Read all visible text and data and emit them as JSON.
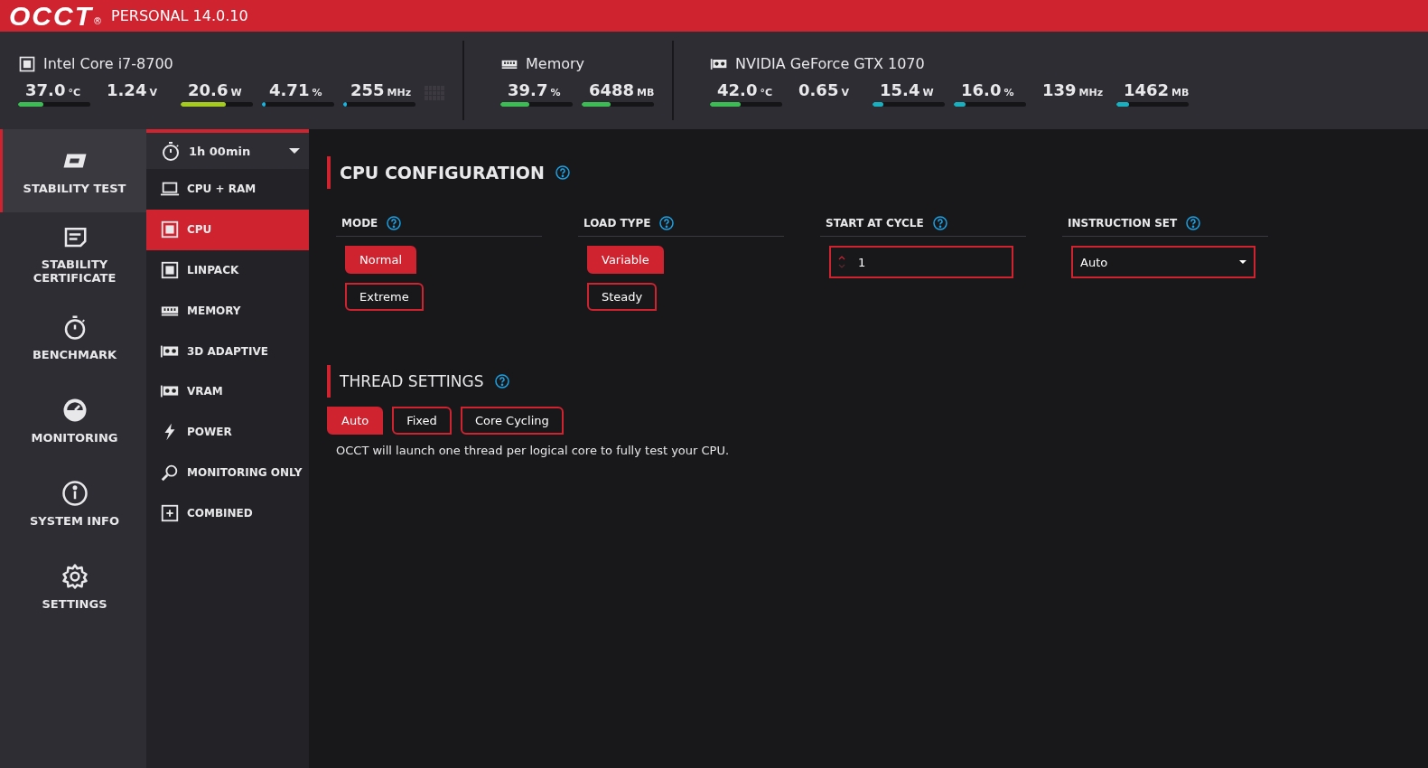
{
  "header": {
    "logo": "OCCT",
    "registered": "®",
    "edition": "PERSONAL 14.0.10"
  },
  "monitors": [
    {
      "kind": "cpu",
      "name": "Intel Core i7-8700",
      "metrics": [
        {
          "value": "37.0",
          "unit": "°C",
          "level": 0.35,
          "color": "#3dbb55"
        },
        {
          "value": "1.24",
          "unit": "V"
        },
        {
          "value": "20.6",
          "unit": "W",
          "level": 0.63,
          "color": "#a5cc1f"
        },
        {
          "value": "4.71",
          "unit": "%",
          "level": 0.05,
          "color": "#1cb5e0"
        },
        {
          "value": "255",
          "unit": "MHz",
          "level": 0.05,
          "color": "#1cb5e0"
        }
      ]
    },
    {
      "kind": "memory",
      "name": "Memory",
      "metrics": [
        {
          "value": "39.7",
          "unit": "%",
          "level": 0.4,
          "color": "#3dbb55"
        },
        {
          "value": "6488",
          "unit": "MB",
          "level": 0.4,
          "color": "#3dbb55"
        }
      ]
    },
    {
      "kind": "gpu",
      "name": "NVIDIA GeForce GTX 1070",
      "metrics": [
        {
          "value": "42.0",
          "unit": "°C",
          "level": 0.42,
          "color": "#3dbb55"
        },
        {
          "value": "0.65",
          "unit": "V"
        },
        {
          "value": "15.4",
          "unit": "W",
          "level": 0.15,
          "color": "#1ab0c0"
        },
        {
          "value": "16.0",
          "unit": "%",
          "level": 0.16,
          "color": "#1ab0c0"
        },
        {
          "value": "139",
          "unit": "MHz"
        },
        {
          "value": "1462",
          "unit": "MB",
          "level": 0.18,
          "color": "#1ab0c0"
        }
      ]
    }
  ],
  "nav": [
    {
      "kind": "stability",
      "label": "STABILITY TEST",
      "selected": true
    },
    {
      "kind": "certificate",
      "label": "STABILITY CERTIFICATE",
      "selected": false
    },
    {
      "kind": "benchmark",
      "label": "BENCHMARK",
      "selected": false
    },
    {
      "kind": "monitoring",
      "label": "MONITORING",
      "selected": false
    },
    {
      "kind": "info",
      "label": "SYSTEM INFO",
      "selected": false
    },
    {
      "kind": "settings",
      "label": "SETTINGS",
      "selected": false
    }
  ],
  "duration": {
    "value": "1h 00min"
  },
  "tests": [
    {
      "kind": "laptop",
      "label": "CPU + RAM",
      "selected": false
    },
    {
      "kind": "chip",
      "label": "CPU",
      "selected": true
    },
    {
      "kind": "chip",
      "label": "LINPACK",
      "selected": false
    },
    {
      "kind": "ram",
      "label": "MEMORY",
      "selected": false
    },
    {
      "kind": "gpu",
      "label": "3D ADAPTIVE",
      "selected": false
    },
    {
      "kind": "gpu",
      "label": "VRAM",
      "selected": false
    },
    {
      "kind": "bolt",
      "label": "POWER",
      "selected": false
    },
    {
      "kind": "search",
      "label": "MONITORING ONLY",
      "selected": false
    },
    {
      "kind": "plus",
      "label": "COMBINED",
      "selected": false
    }
  ],
  "cpu_configuration": {
    "title": "CPU CONFIGURATION",
    "columns": [
      {
        "kind": "options",
        "label": "MODE",
        "options": [
          {
            "label": "Normal",
            "selected": true
          },
          {
            "label": "Extreme",
            "selected": false
          }
        ]
      },
      {
        "kind": "options",
        "label": "LOAD TYPE",
        "options": [
          {
            "label": "Variable",
            "selected": true
          },
          {
            "label": "Steady",
            "selected": false
          }
        ]
      },
      {
        "kind": "spin",
        "label": "START AT CYCLE",
        "value": "1"
      },
      {
        "kind": "select",
        "label": "INSTRUCTION SET",
        "value": "Auto"
      }
    ]
  },
  "thread_settings": {
    "title": "THREAD SETTINGS",
    "options": [
      {
        "label": "Auto",
        "selected": true
      },
      {
        "label": "Fixed",
        "selected": false
      },
      {
        "label": "Core Cycling",
        "selected": false
      }
    ],
    "description": "OCCT will launch one thread per logical core to fully test your CPU."
  }
}
